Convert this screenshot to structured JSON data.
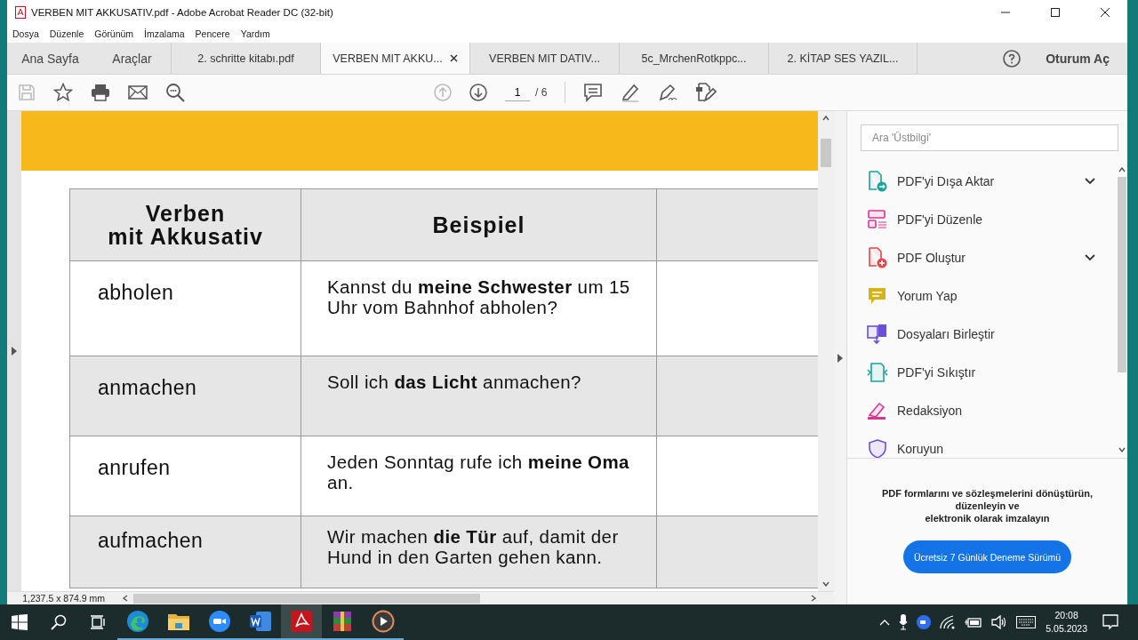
{
  "window": {
    "title": "VERBEN MIT AKKUSATIV.pdf - Adobe Acrobat Reader DC (32-bit)"
  },
  "menu": [
    "Dosya",
    "Düzenle",
    "Görünüm",
    "İmzalama",
    "Pencere",
    "Yardım"
  ],
  "tabs": [
    {
      "label": "Ana Sayfa",
      "kind": "nav",
      "selected": false
    },
    {
      "label": "Araçlar",
      "kind": "nav",
      "selected": false
    },
    {
      "label": "2. schritte kitabı.pdf",
      "kind": "doc",
      "selected": false
    },
    {
      "label": "VERBEN MIT AKKU...",
      "kind": "doc",
      "selected": true
    },
    {
      "label": "VERBEN MIT DATIV...",
      "kind": "doc",
      "selected": false
    },
    {
      "label": "5c_MrchenRotkppc...",
      "kind": "doc",
      "selected": false
    },
    {
      "label": "2.  KİTAP SES YAZIL...",
      "kind": "doc",
      "selected": false
    }
  ],
  "account": {
    "label": "Oturum Aç"
  },
  "toolbar": {
    "page": "1",
    "total": "/ 6"
  },
  "table": {
    "columns": [
      "Verben\nmit Akkusativ",
      "Beispiel"
    ],
    "rows": [
      {
        "verb": "abholen",
        "example": "Kannst du **meine Schwester** um 15 Uhr vom Bahnhof abholen?",
        "shaded": false
      },
      {
        "verb": "anmachen",
        "example": "Soll ich **das Licht** anmachen?",
        "shaded": true
      },
      {
        "verb": "anrufen",
        "example": "Jeden Sonntag rufe ich **meine Oma** an.",
        "shaded": false
      },
      {
        "verb": "aufmachen",
        "example": "Wir machen **die Tür** auf, damit der Hund in den Garten gehen kann.",
        "shaded": true
      }
    ]
  },
  "status_bar": {
    "size": "1,237.5 x 874.9 mm"
  },
  "panel": {
    "search": {
      "placeholder": "Ara 'Üstbilgi'"
    },
    "tools": [
      {
        "label": "PDF'yi Dışa Aktar",
        "kind": "export",
        "expandable": true
      },
      {
        "label": "PDF'yi Düzenle",
        "kind": "edit",
        "expandable": false
      },
      {
        "label": "PDF Oluştur",
        "kind": "create",
        "expandable": true
      },
      {
        "label": "Yorum Yap",
        "kind": "comment",
        "expandable": false
      },
      {
        "label": "Dosyaları Birleştir",
        "kind": "combine",
        "expandable": false
      },
      {
        "label": "PDF'yi Sıkıştır",
        "kind": "compress",
        "expandable": false
      },
      {
        "label": "Redaksiyon",
        "kind": "redact",
        "expandable": false
      },
      {
        "label": "Koruyun",
        "kind": "protect",
        "expandable": false
      }
    ],
    "promo": "PDF formlarını ve sözleşmelerini dönüştürün,\ndüzenleyin ve\nelektronik olarak imzalayın",
    "button": "Ücretsiz 7 Günlük Deneme Sürümü"
  },
  "taskbar": {
    "apps": [
      {
        "kind": "edge",
        "active": false
      },
      {
        "kind": "explorer",
        "active": false
      },
      {
        "kind": "zoom",
        "active": false
      },
      {
        "kind": "word",
        "active": false
      },
      {
        "kind": "acrobat",
        "active": true
      },
      {
        "kind": "winrar",
        "active": false
      },
      {
        "kind": "player",
        "active": false
      }
    ],
    "time": "20:08",
    "date": "5.05.2023"
  }
}
